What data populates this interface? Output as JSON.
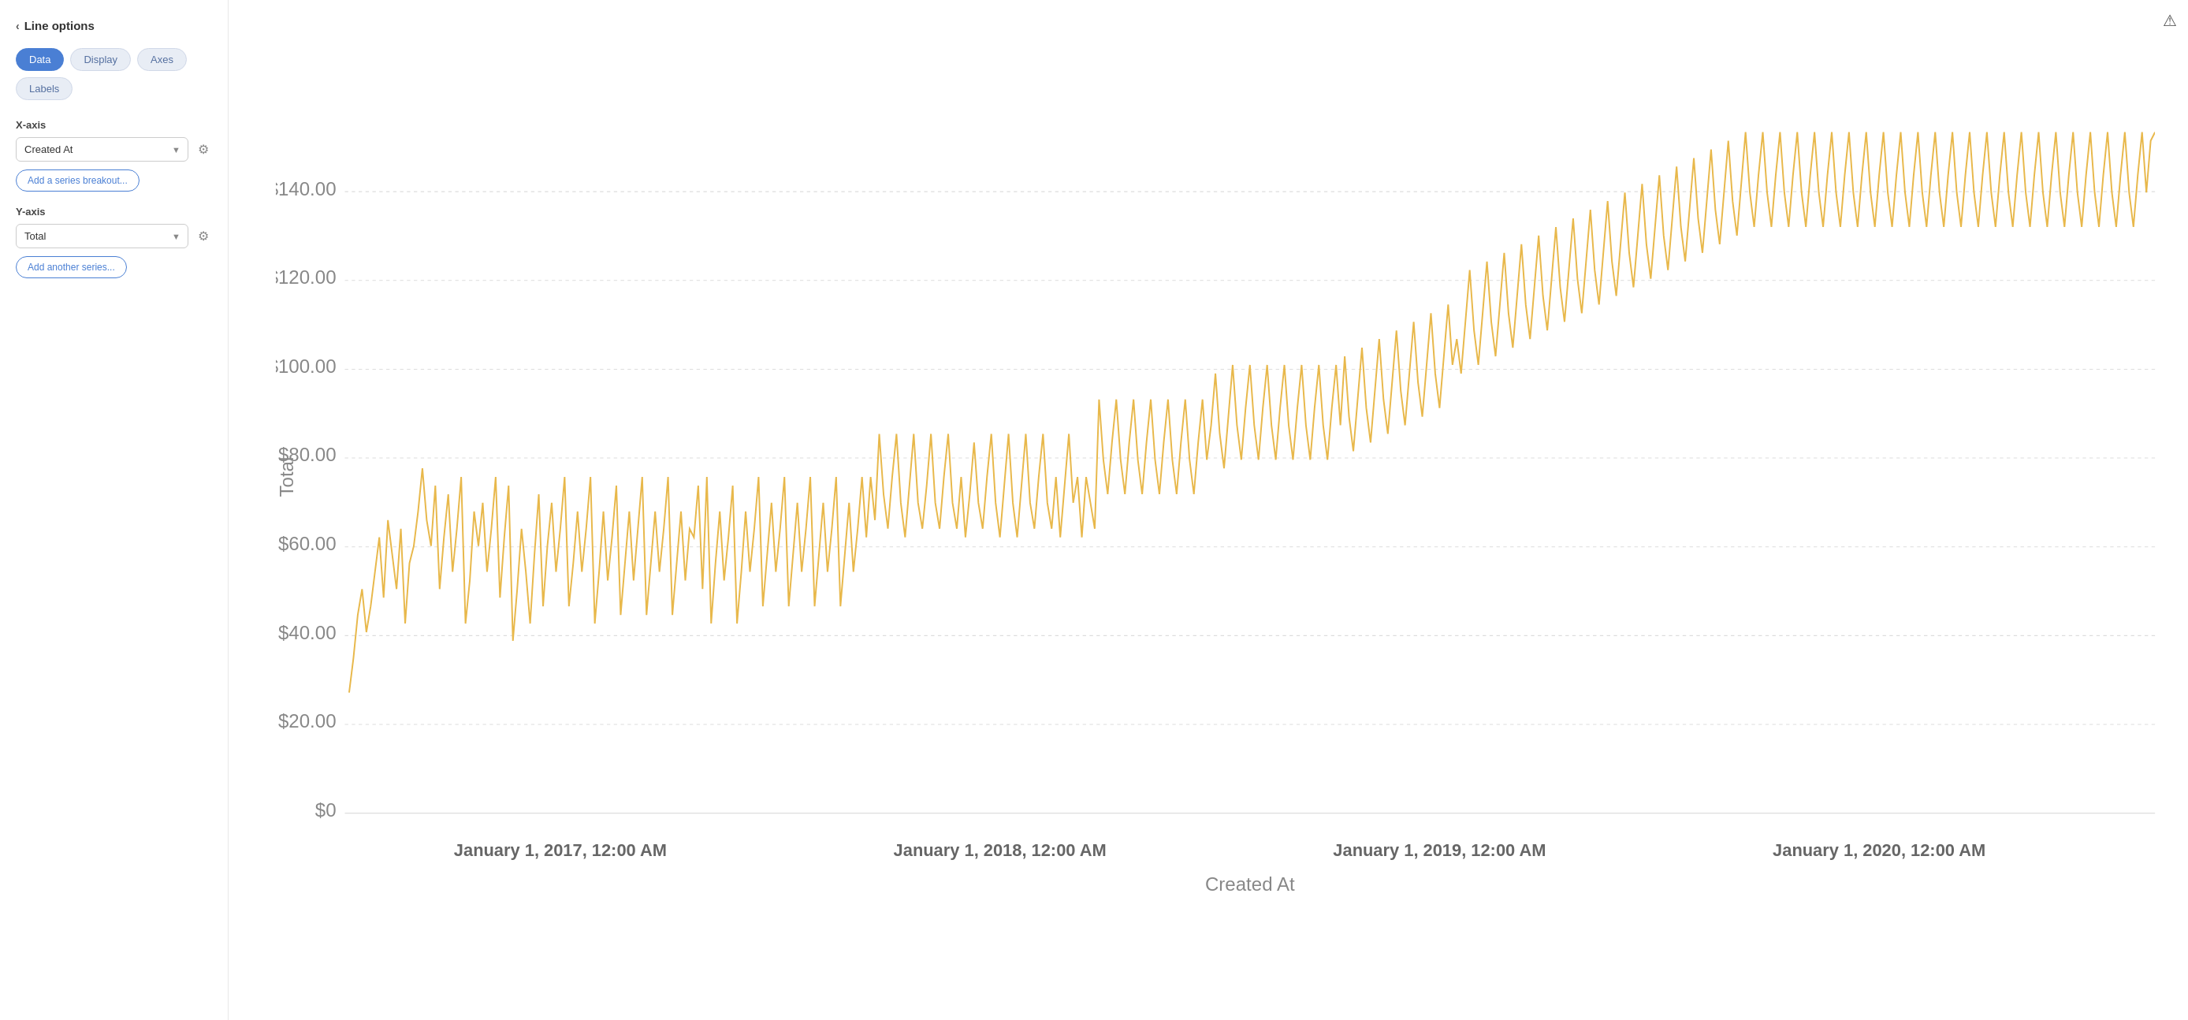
{
  "back": {
    "label": "Line options",
    "chevron": "‹"
  },
  "tabs": [
    {
      "id": "data",
      "label": "Data",
      "active": true
    },
    {
      "id": "display",
      "label": "Display",
      "active": false
    },
    {
      "id": "axes",
      "label": "Axes",
      "active": false
    },
    {
      "id": "labels",
      "label": "Labels",
      "active": false
    }
  ],
  "xaxis": {
    "label": "X-axis",
    "value": "Created At",
    "gear_title": "X-axis settings"
  },
  "xaxis_breakout": {
    "label": "Add a series breakout..."
  },
  "yaxis": {
    "label": "Y-axis",
    "value": "Total",
    "gear_title": "Y-axis settings"
  },
  "yaxis_series": {
    "label": "Add another series..."
  },
  "chart": {
    "warning_icon": "⚠",
    "y_axis_label": "Total",
    "x_axis_label": "Created At",
    "y_ticks": [
      "$0",
      "$20.00",
      "$40.00",
      "$60.00",
      "$80.00",
      "$100.00",
      "$120.00",
      "$140.00"
    ],
    "x_ticks": [
      "January 1, 2017, 12:00 AM",
      "January 1, 2018, 12:00 AM",
      "January 1, 2019, 12:00 AM",
      "January 1, 2020, 12:00 AM"
    ],
    "line_color": "#E8B84B"
  }
}
